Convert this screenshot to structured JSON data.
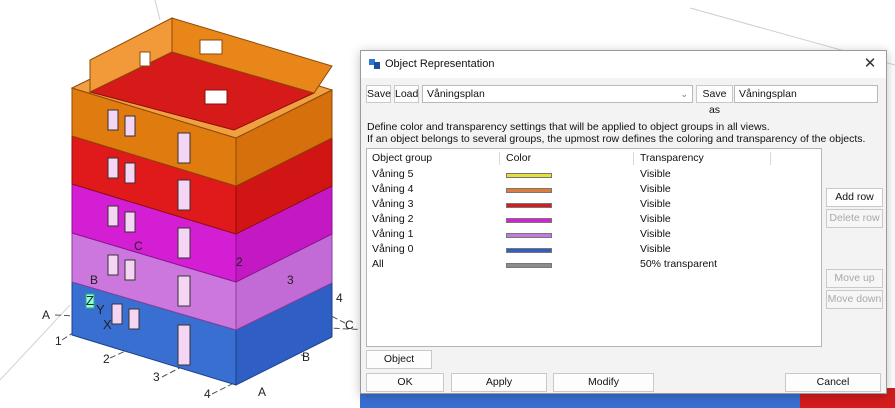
{
  "background": {
    "axis_labels": [
      "A",
      "B",
      "C",
      "1",
      "2",
      "3",
      "4",
      "A",
      "B",
      "C",
      "2",
      "3",
      "4"
    ],
    "gizmo": {
      "z": "Z",
      "y": "Y",
      "x": "X"
    },
    "floor_colors": [
      "#e07b10",
      "#e01a1a",
      "#d41ed4",
      "#cc77dd",
      "#3a6fd2"
    ]
  },
  "dialog": {
    "title": "Object Representation",
    "close_glyph": "✕",
    "toolbar": {
      "save_label": "Save",
      "load_label": "Load",
      "load_value": "Våningsplan",
      "save_as_label": "Save as",
      "save_as_value": "Våningsplan"
    },
    "description": [
      "Define color and transparency settings that will be applied to object groups in all views.",
      "If an object belongs to several groups, the upmost row defines the coloring and transparency of the objects."
    ],
    "columns": [
      "Object group",
      "Color",
      "Transparency"
    ],
    "rows": [
      {
        "group": "Våning 5",
        "color": "#e3e03a",
        "transparency": "Visible"
      },
      {
        "group": "Våning 4",
        "color": "#e07b3a",
        "transparency": "Visible"
      },
      {
        "group": "Våning 3",
        "color": "#d41c1c",
        "transparency": "Visible"
      },
      {
        "group": "Våning 2",
        "color": "#d61fd6",
        "transparency": "Visible"
      },
      {
        "group": "Våning 1",
        "color": "#c27ae0",
        "transparency": "Visible"
      },
      {
        "group": "Våning 0",
        "color": "#2f5fc4",
        "transparency": "Visible"
      },
      {
        "group": "All",
        "color": "#8c8c8c",
        "transparency": "50% transparent"
      }
    ],
    "side_buttons": {
      "add_row": "Add row",
      "delete_row": "Delete row",
      "move_up": "Move up",
      "move_down": "Move down"
    },
    "object_group_button": "Object group...",
    "footer": {
      "ok": "OK",
      "apply": "Apply",
      "modify": "Modify",
      "cancel": "Cancel"
    }
  }
}
